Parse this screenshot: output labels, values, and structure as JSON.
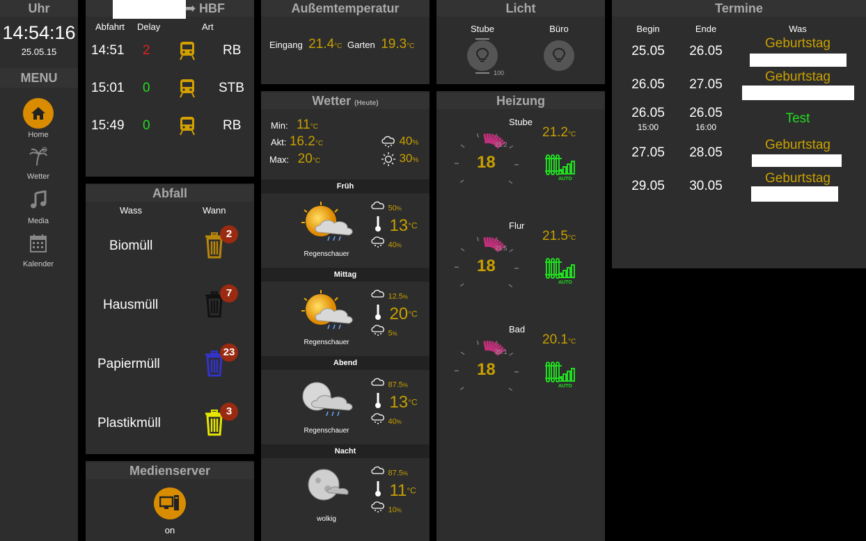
{
  "clock": {
    "title": "Uhr",
    "time": "14:54:16",
    "date": "25.05.15"
  },
  "menu": {
    "title": "MENU",
    "items": [
      {
        "label": "Home",
        "icon": "home-icon"
      },
      {
        "label": "Wetter",
        "icon": "palm-weather-icon"
      },
      {
        "label": "Media",
        "icon": "music-note-icon"
      },
      {
        "label": "Kalender",
        "icon": "calendar-icon"
      }
    ]
  },
  "trains": {
    "title_suffix": "HBF",
    "arrow": "➡",
    "columns": [
      "Abfahrt",
      "Delay",
      "Art"
    ],
    "rows": [
      {
        "time": "14:51",
        "delay": "2",
        "type": "RB",
        "delay_color": "#e02020"
      },
      {
        "time": "15:01",
        "delay": "0",
        "type": "STB",
        "delay_color": "#22dd22"
      },
      {
        "time": "15:49",
        "delay": "0",
        "type": "RB",
        "delay_color": "#22dd22"
      }
    ]
  },
  "waste": {
    "title": "Abfall",
    "columns": [
      "Wass",
      "Wann"
    ],
    "items": [
      {
        "name": "Biomüll",
        "days": "2",
        "color": "#b8860b"
      },
      {
        "name": "Hausmüll",
        "days": "7",
        "color": "#111111"
      },
      {
        "name": "Papiermüll",
        "days": "23",
        "color": "#3333cc"
      },
      {
        "name": "Plastikmüll",
        "days": "3",
        "color": "#e6e600"
      }
    ]
  },
  "media": {
    "title": "Medienserver",
    "status": "on"
  },
  "outside": {
    "title": "Außemtemperatur",
    "entries": [
      {
        "label": "Eingang",
        "value": "21.4",
        "unit": "°C"
      },
      {
        "label": "Garten",
        "value": "19.3",
        "unit": "°C"
      }
    ]
  },
  "weather": {
    "title": "Wetter",
    "subtitle": "(Heute)",
    "min_label": "Min:",
    "min": "11",
    "akt_label": "Akt:",
    "akt": "16.2",
    "max_label": "Max:",
    "max": "20",
    "unit": "°C",
    "rain": "40",
    "sun": "30",
    "pct": "%",
    "periods": [
      {
        "name": "Früh",
        "desc": "Regenschauer",
        "cloud": "50",
        "temp": "13",
        "rain": "40",
        "kind": "sun-rain"
      },
      {
        "name": "Mittag",
        "desc": "Regenschauer",
        "cloud": "12.5",
        "temp": "20",
        "rain": "5",
        "kind": "sun-rain"
      },
      {
        "name": "Abend",
        "desc": "Regenschauer",
        "cloud": "87.5",
        "temp": "13",
        "rain": "40",
        "kind": "moon-rain"
      },
      {
        "name": "Nacht",
        "desc": "wolkig",
        "cloud": "87.5",
        "temp": "11",
        "rain": "10",
        "kind": "moon-cloud"
      }
    ]
  },
  "light": {
    "title": "Licht",
    "items": [
      {
        "name": "Stube",
        "level": "100"
      },
      {
        "name": "Büro"
      }
    ]
  },
  "heating": {
    "title": "Heizung",
    "rooms": [
      {
        "name": "Stube",
        "setpoint": "18",
        "dial_value": "21.2",
        "actual": "21.2",
        "mode": "AUTO"
      },
      {
        "name": "Flur",
        "setpoint": "18",
        "dial_value": "21.5",
        "actual": "21.5",
        "mode": "AUTO"
      },
      {
        "name": "Bad",
        "setpoint": "18",
        "dial_value": "20.1",
        "actual": "20.1",
        "mode": "AUTO"
      }
    ],
    "unit": "°C"
  },
  "events": {
    "title": "Termine",
    "columns": [
      "Begin",
      "Ende",
      "Was"
    ],
    "rows": [
      {
        "begin": "25.05",
        "end": "26.05",
        "what": "Geburtstag",
        "begin_time": "",
        "end_time": "",
        "color": "#c8a000"
      },
      {
        "begin": "26.05",
        "end": "27.05",
        "what": "Geburtstag",
        "begin_time": "",
        "end_time": "",
        "color": "#c8a000"
      },
      {
        "begin": "26.05",
        "end": "26.05",
        "what": "Test",
        "begin_time": "15:00",
        "end_time": "16:00",
        "color": "#22dd22"
      },
      {
        "begin": "27.05",
        "end": "28.05",
        "what": "Geburtstag",
        "begin_time": "",
        "end_time": "",
        "color": "#c8a000"
      },
      {
        "begin": "29.05",
        "end": "30.05",
        "what": "Geburtstag",
        "begin_time": "",
        "end_time": "",
        "color": "#c8a000"
      }
    ]
  }
}
